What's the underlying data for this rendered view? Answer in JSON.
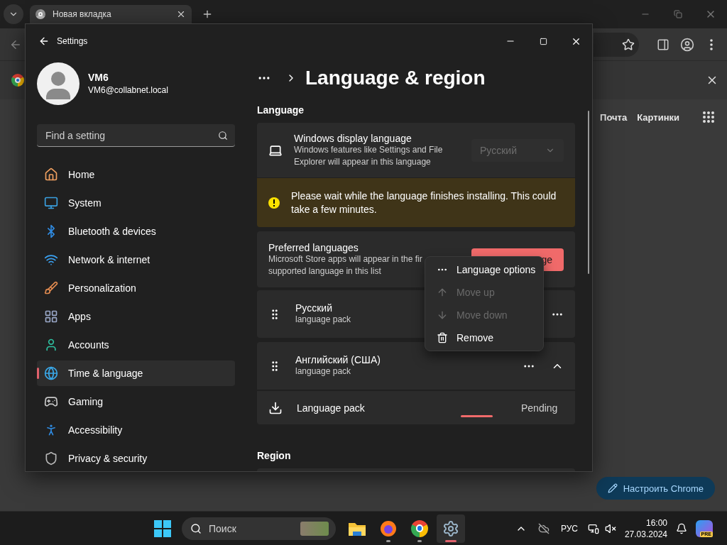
{
  "browser": {
    "tab": {
      "title": "Новая вкладка"
    },
    "page_links": [
      "Почта",
      "Картинки"
    ],
    "customize_button": "Настроить Chrome"
  },
  "settings": {
    "window_title": "Settings",
    "account": {
      "name": "VM6",
      "email": "VM6@collabnet.local"
    },
    "search": {
      "placeholder": "Find a setting"
    },
    "nav": [
      {
        "label": "Home",
        "kind": "home",
        "selected": false
      },
      {
        "label": "System",
        "kind": "system",
        "selected": false
      },
      {
        "label": "Bluetooth & devices",
        "kind": "bluetooth",
        "selected": false
      },
      {
        "label": "Network & internet",
        "kind": "network",
        "selected": false
      },
      {
        "label": "Personalization",
        "kind": "brush",
        "selected": false
      },
      {
        "label": "Apps",
        "kind": "apps",
        "selected": false
      },
      {
        "label": "Accounts",
        "kind": "accounts",
        "selected": false
      },
      {
        "label": "Time & language",
        "kind": "time",
        "selected": true
      },
      {
        "label": "Gaming",
        "kind": "gaming",
        "selected": false
      },
      {
        "label": "Accessibility",
        "kind": "accessibility",
        "selected": false
      },
      {
        "label": "Privacy & security",
        "kind": "privacy",
        "selected": false
      }
    ],
    "page_title": "Language & region",
    "language_section": {
      "header": "Language",
      "display_language": {
        "title": "Windows display language",
        "description": "Windows features like Settings and File Explorer will appear in this language",
        "value": "Русский",
        "disabled": true
      },
      "notice": "Please wait while the language finishes installing. This could take a few minutes.",
      "preferred": {
        "title": "Preferred languages",
        "description_lines": [
          "Microsoft Store apps will appear in the fir",
          "supported language in this list"
        ],
        "button": "ge"
      },
      "languages": [
        {
          "name": "Русский",
          "subtitle": "language pack"
        },
        {
          "name": "Английский (США)",
          "subtitle": "language pack",
          "expanded": true,
          "features": [
            {
              "name": "Language pack",
              "status": "Pending",
              "level": 0.75
            }
          ]
        }
      ]
    },
    "region_section": {
      "header": "Region"
    },
    "context_menu": [
      {
        "label": "Language options",
        "kind": "more",
        "disabled": false
      },
      {
        "label": "Move up",
        "kind": "up",
        "disabled": true
      },
      {
        "label": "Move down",
        "kind": "down",
        "disabled": true
      },
      {
        "label": "Remove",
        "kind": "trash",
        "disabled": false
      }
    ]
  },
  "taskbar": {
    "search_placeholder": "Поиск",
    "apps": [
      {
        "kind": "files",
        "running": false,
        "active": false
      },
      {
        "kind": "firefox",
        "running": true,
        "active": false
      },
      {
        "kind": "chrome",
        "running": true,
        "active": false
      },
      {
        "kind": "settings",
        "running": true,
        "active": true
      }
    ],
    "input_language": "РУС",
    "time": "16:00",
    "date": "27.03.2024",
    "copilot_badge": "PRE"
  }
}
